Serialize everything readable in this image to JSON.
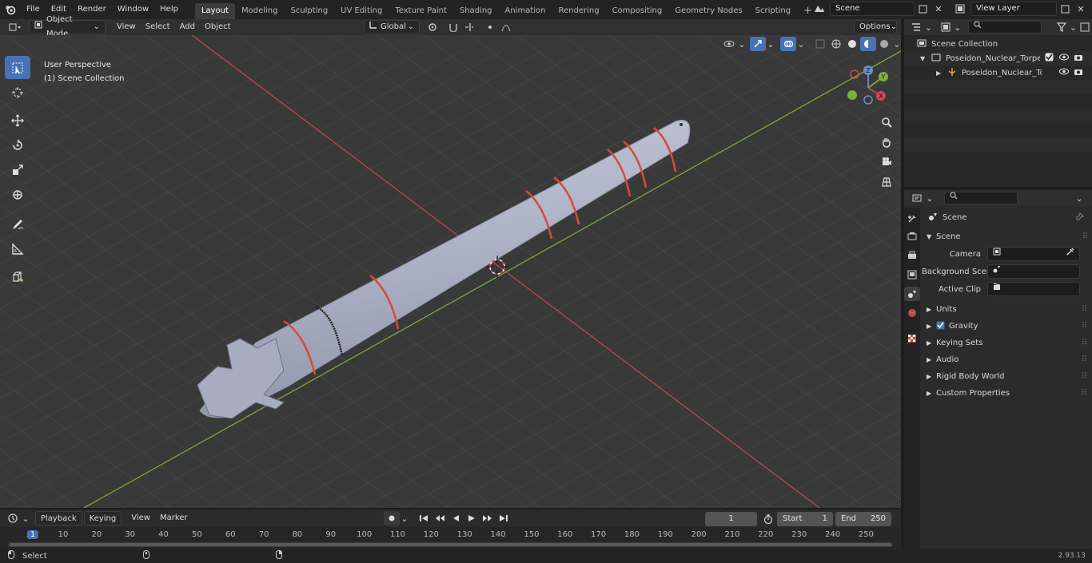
{
  "topbar": {
    "menus": [
      "File",
      "Edit",
      "Render",
      "Window",
      "Help"
    ],
    "workspaces": [
      "Layout",
      "Modeling",
      "Sculpting",
      "UV Editing",
      "Texture Paint",
      "Shading",
      "Animation",
      "Rendering",
      "Compositing",
      "Geometry Nodes",
      "Scripting"
    ],
    "add_tab": "+",
    "scene_name": "Scene",
    "view_layer": "View Layer"
  },
  "viewport_header": {
    "mode": "Object Mode",
    "menus": [
      "View",
      "Select",
      "Add",
      "Object"
    ],
    "transform_orientation": "Global",
    "options": "Options"
  },
  "viewport": {
    "perspective_label": "User Perspective",
    "collection_label": "(1) Scene Collection",
    "gizmo_axes": [
      "Z",
      "Y",
      "X"
    ]
  },
  "outliner": {
    "root": "Scene Collection",
    "items": [
      {
        "label": "Poseidon_Nuclear_Torpedoes_"
      },
      {
        "label": "Poseidon_Nuclear_Torpec"
      }
    ]
  },
  "properties": {
    "context": "Scene",
    "panel_title": "Scene",
    "rows": [
      {
        "label": "Camera"
      },
      {
        "label": "Background Scene"
      },
      {
        "label": "Active Clip"
      }
    ],
    "subpanels": [
      "Units",
      "Gravity",
      "Keying Sets",
      "Audio",
      "Rigid Body World",
      "Custom Properties"
    ]
  },
  "timeline": {
    "menus": [
      "Playback",
      "Keying",
      "View",
      "Marker"
    ],
    "current_frame": "1",
    "start_label": "Start",
    "start": "1",
    "end_label": "End",
    "end": "250",
    "ruler": [
      "1",
      "10",
      "20",
      "30",
      "40",
      "50",
      "60",
      "70",
      "80",
      "90",
      "100",
      "110",
      "120",
      "130",
      "140",
      "150",
      "160",
      "170",
      "180",
      "190",
      "200",
      "210",
      "220",
      "230",
      "240",
      "250"
    ]
  },
  "statusbar": {
    "left": "Select",
    "version": "2.93.13"
  },
  "colors": {
    "accent": "#4772b3",
    "x_axis": "#b54a4a",
    "y_axis": "#7aa83a",
    "torpedo": "#aeb4c8",
    "stripe": "#d84a3a"
  }
}
